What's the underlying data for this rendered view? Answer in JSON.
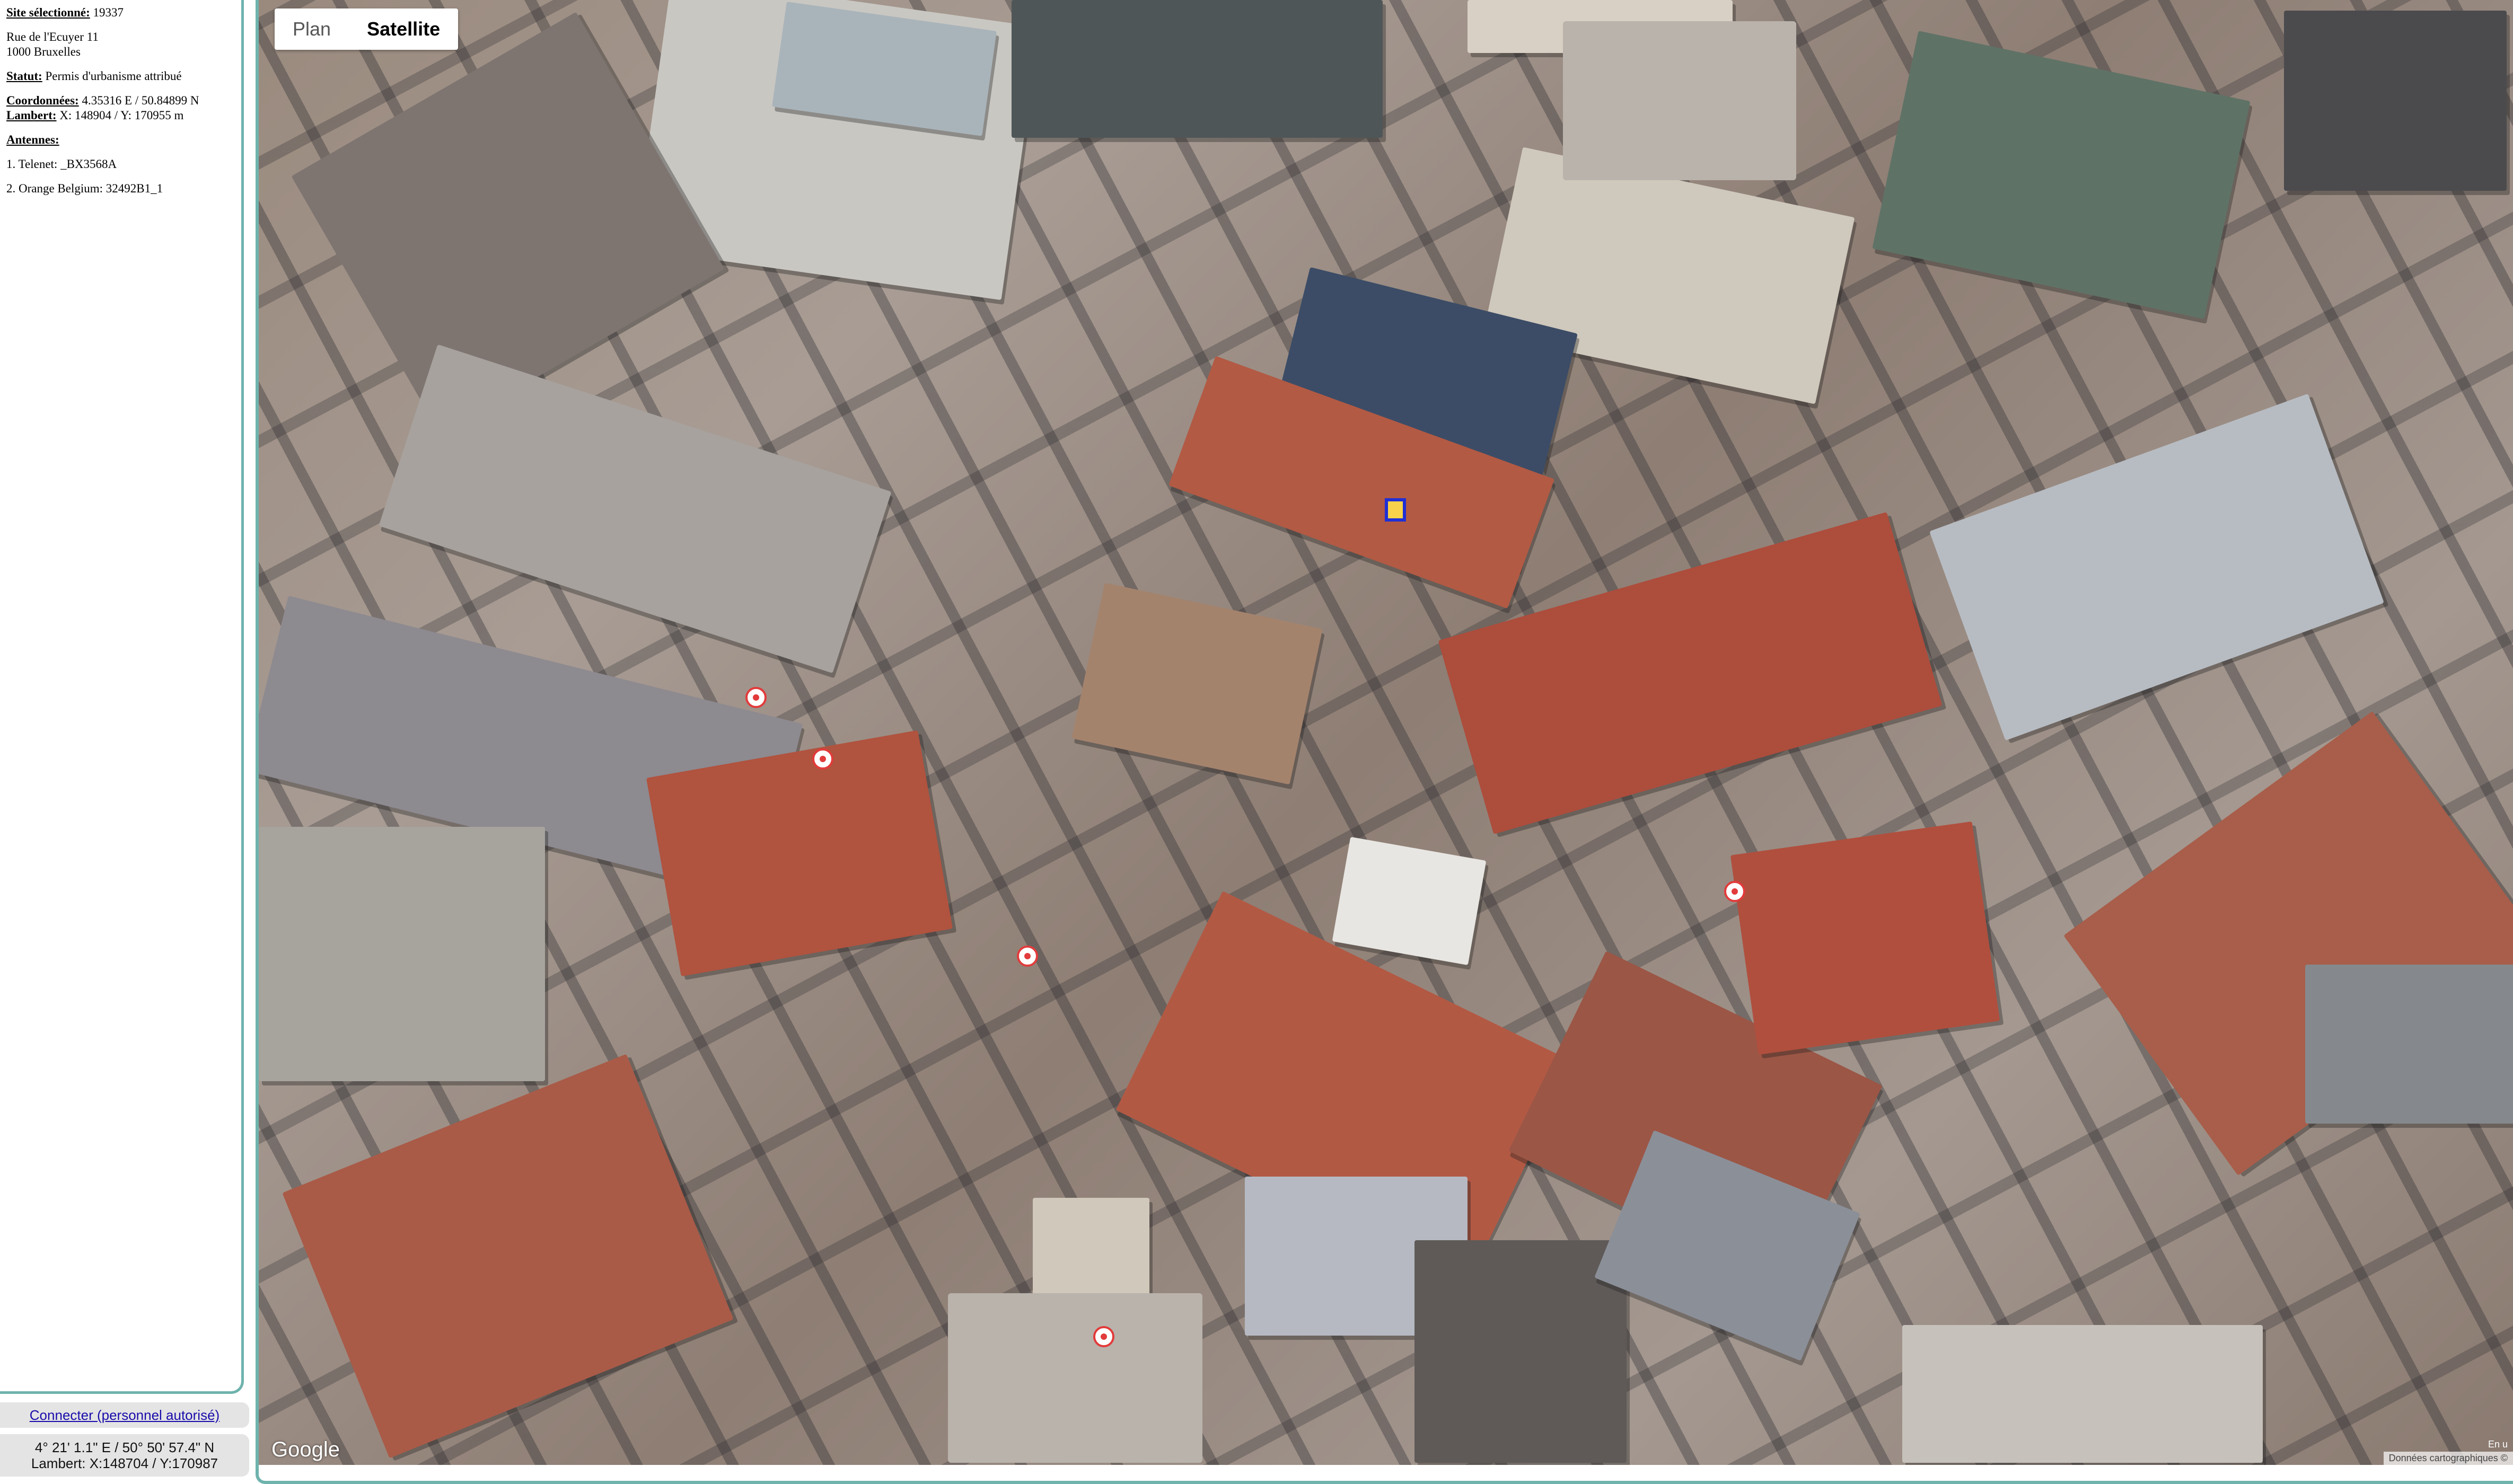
{
  "sidebar": {
    "site_label": "Site sélectionné:",
    "site_id": "19337",
    "address_line1": "Rue de l'Ecuyer 11",
    "address_line2": "1000 Bruxelles",
    "statut_label": "Statut:",
    "statut_value": "Permis d'urbanisme attribué",
    "coords_label": "Coordonnées:",
    "coords_value": "4.35316 E / 50.84899 N",
    "lambert_label": "Lambert:",
    "lambert_value": "X: 148904 / Y: 170955 m",
    "antennas_label": "Antennes:",
    "antennas": [
      "1. Telenet: _BX3568A",
      "2. Orange Belgium: 32492B1_1"
    ]
  },
  "footer": {
    "connect_label": "Connecter (personnel autorisé)",
    "cursor_coords_line1": "4° 21' 1.1\" E / 50° 50' 57.4\" N",
    "cursor_coords_line2": "Lambert: X:148704 / Y:170987"
  },
  "map": {
    "type_options": [
      "Plan",
      "Satellite"
    ],
    "selected_type": "Satellite",
    "logo_text": "Google",
    "attribution_text": "Données cartographiques ©",
    "attribution_top_text": "En u"
  },
  "colors": {
    "frame_accent": "#6fb3ad",
    "marker_red": "#e23b3b",
    "selected_marker_blue": "#1f2fd6",
    "link_blue": "#1a0dab"
  }
}
